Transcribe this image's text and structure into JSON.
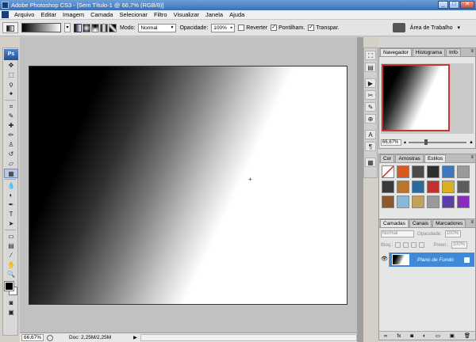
{
  "window": {
    "title": "Adobe Photoshop CS3 - [Sem Título-1 @ 66,7% (RGB/8)]",
    "buttons": {
      "minimize": "_",
      "maximize": "□",
      "close": "✕"
    }
  },
  "menu": [
    "Arquivo",
    "Editar",
    "Imagem",
    "Camada",
    "Selecionar",
    "Filtro",
    "Visualizar",
    "Janela",
    "Ajuda"
  ],
  "options": {
    "mode_label": "Modo:",
    "mode_value": "Normal",
    "opacity_label": "Opacidade:",
    "opacity_value": "100%",
    "reverse_label": "Reverter",
    "dither_label": "Pontilham.",
    "transparency_label": "Transpar.",
    "reverse_checked": false,
    "dither_checked": true,
    "transparency_checked": true,
    "workspace_label": "Área de Trabalho"
  },
  "tools": {
    "ps_badge": "Ps",
    "items": [
      {
        "name": "move-tool",
        "glyph": "✥"
      },
      {
        "name": "marquee-tool",
        "glyph": "⬚"
      },
      {
        "name": "lasso-tool",
        "glyph": "ϙ"
      },
      {
        "name": "magic-wand-tool",
        "glyph": "✦"
      },
      {
        "name": "crop-tool",
        "glyph": "⌗"
      },
      {
        "name": "slice-tool",
        "glyph": "✎"
      },
      {
        "name": "healing-brush-tool",
        "glyph": "✚"
      },
      {
        "name": "brush-tool",
        "glyph": "✏"
      },
      {
        "name": "clone-stamp-tool",
        "glyph": "♙"
      },
      {
        "name": "history-brush-tool",
        "glyph": "↺"
      },
      {
        "name": "eraser-tool",
        "glyph": "▱"
      },
      {
        "name": "gradient-tool",
        "glyph": "▦"
      },
      {
        "name": "blur-tool",
        "glyph": "💧"
      },
      {
        "name": "dodge-tool",
        "glyph": "◐"
      },
      {
        "name": "pen-tool",
        "glyph": "✒"
      },
      {
        "name": "type-tool",
        "glyph": "T"
      },
      {
        "name": "path-selection-tool",
        "glyph": "➤"
      },
      {
        "name": "shape-tool",
        "glyph": "▭"
      },
      {
        "name": "notes-tool",
        "glyph": "▤"
      },
      {
        "name": "eyedropper-tool",
        "glyph": "⁄"
      },
      {
        "name": "hand-tool",
        "glyph": "✋"
      },
      {
        "name": "zoom-tool",
        "glyph": "🔍"
      }
    ],
    "bottom": [
      {
        "name": "quick-mask-icon",
        "glyph": "◙"
      },
      {
        "name": "screen-mode-icon",
        "glyph": "▣"
      }
    ]
  },
  "status": {
    "zoom": "66,67%",
    "doc": "Doc: 2,25M/2,25M",
    "arrow": "▶"
  },
  "navigator": {
    "tabs": [
      "Navegador",
      "Histograma",
      "Info"
    ],
    "zoom": "66,67%"
  },
  "styles_panel": {
    "tabs": [
      "Cor",
      "Amostras",
      "Estilos"
    ],
    "swatches": [
      "#ffffff",
      "#d85a1c",
      "#4a4a4a",
      "#2f2f2f",
      "#3d77c0",
      "#9a9a9a",
      "#3a3a3a",
      "#b9762a",
      "#2b6b9c",
      "#c42f2f",
      "#d8b020",
      "#5c5c5c",
      "#8c5a2c",
      "#8bb8d8",
      "#c2a15a",
      "#9a9a9a",
      "#5b3ea8",
      "#8a2cc0"
    ]
  },
  "layers_panel": {
    "tabs": [
      "Camadas",
      "Canais",
      "Marcadores"
    ],
    "blend_mode": "Normal",
    "opacity_label": "Opacidade:",
    "opacity_value": "100%",
    "lock_label": "Bloq.:",
    "fill_label": "Preen.:",
    "fill_value": "100%",
    "layer_name": "Plano de Fundo",
    "footer_icons": [
      "∞",
      "fx",
      "◙",
      "◐",
      "▭",
      "▣",
      "🗑"
    ]
  },
  "dock_icons": [
    {
      "name": "navigator-dock-icon",
      "glyph": "⛶"
    },
    {
      "name": "history-dock-icon",
      "glyph": "▤"
    },
    {
      "name": "actions-dock-icon",
      "glyph": "▶"
    },
    {
      "name": "tool-presets-dock-icon",
      "glyph": "✂"
    },
    {
      "name": "brushes-dock-icon",
      "glyph": "✎"
    },
    {
      "name": "clone-source-dock-icon",
      "glyph": "⊕"
    },
    {
      "name": "character-dock-icon",
      "glyph": "A"
    },
    {
      "name": "paragraph-dock-icon",
      "glyph": "¶"
    },
    {
      "name": "layer-comps-dock-icon",
      "glyph": "▦"
    }
  ]
}
